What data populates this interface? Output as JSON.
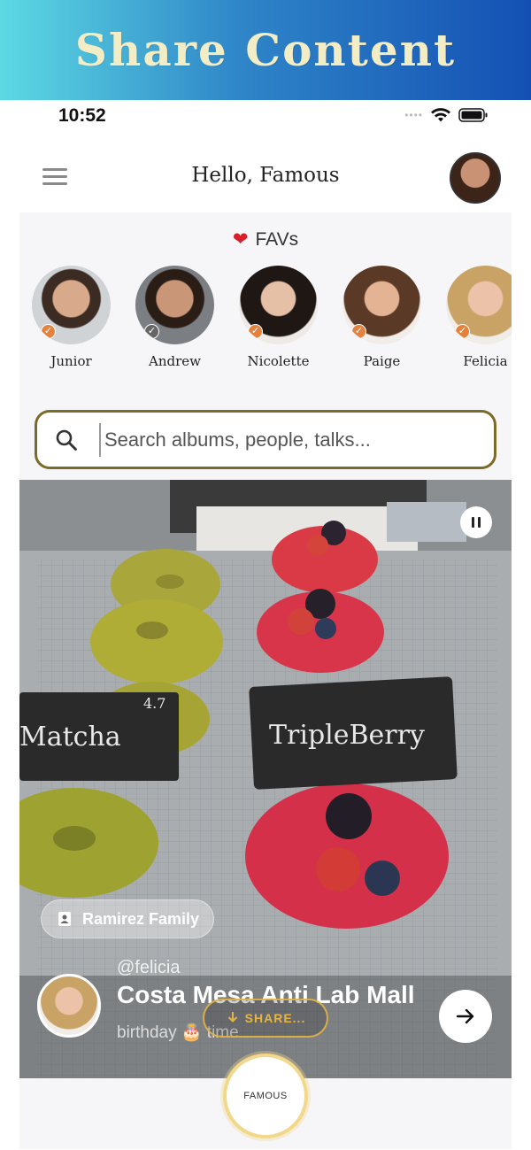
{
  "banner": {
    "title": "Share Content"
  },
  "statusbar": {
    "time": "10:52"
  },
  "header": {
    "greeting": "Hello, Famous"
  },
  "favs": {
    "title": "FAVs",
    "people": [
      {
        "name": "Junior"
      },
      {
        "name": "Andrew"
      },
      {
        "name": "Nicolette"
      },
      {
        "name": "Paige"
      },
      {
        "name": "Felicia"
      }
    ]
  },
  "search": {
    "placeholder": "Search albums, people, talks..."
  },
  "media": {
    "album": "Ramirez Family",
    "handle": "@felicia",
    "location": "Costa Mesa Anti Lab Mall",
    "caption": "birthday 🎂 time",
    "share_label": "SHARE...",
    "sign_left": "Matcha",
    "sign_left_price": "4.7",
    "sign_right": "TripleBerry"
  },
  "nav": {
    "famous_label": "FAMOUS"
  },
  "colors": {
    "accent_gold": "#e6b445",
    "search_border": "#7c6a29",
    "check_orange": "#e3823f"
  }
}
